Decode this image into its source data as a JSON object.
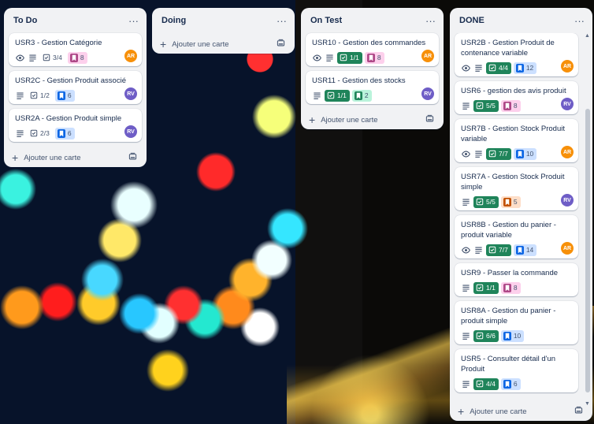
{
  "colors": {
    "check_done": "#1f845a",
    "label_pink": "#fdd0ec",
    "label_pink_icon": "#ae4787",
    "label_blue": "#cce0ff",
    "label_blue_icon": "#0c66e4",
    "label_green": "#baf3db",
    "label_green_icon": "#1f845a",
    "label_orange": "#fedec8",
    "label_orange_icon": "#c25100",
    "avatar_ar": "#f79009",
    "avatar_rv": "#6e5dc6"
  },
  "add_card_label": "Ajouter une carte",
  "menu_glyph": "···",
  "lists": [
    {
      "title": "To Do",
      "cards": [
        {
          "title": "USR3 - Gestion Catégorie",
          "checklist": "3/4",
          "label": "8",
          "avatar": "AR"
        },
        {
          "title": "USR2C - Gestion Produit associé",
          "checklist": "1/2",
          "label": "6",
          "avatar": "RV"
        },
        {
          "title": "USR2A - Gestion Produit simple",
          "checklist": "2/3",
          "label": "6",
          "avatar": "RV"
        }
      ]
    },
    {
      "title": "Doing",
      "cards": []
    },
    {
      "title": "On Test",
      "cards": [
        {
          "title": "USR10 - Gestion des commandes",
          "checklist": "1/1",
          "label": "8",
          "avatar": "AR"
        },
        {
          "title": "USR11 - Gestion des stocks",
          "checklist": "1/1",
          "label": "2",
          "avatar": "RV"
        }
      ]
    },
    {
      "title": "DONE",
      "cards": [
        {
          "title": "USR2B - Gestion Produit de contenance variable",
          "checklist": "4/4",
          "label": "12",
          "avatar": "AR"
        },
        {
          "title": "USR6 - gestion des avis produit",
          "checklist": "5/5",
          "label": "8",
          "avatar": "RV"
        },
        {
          "title": "USR7B - Gestion Stock Produit variable",
          "checklist": "7/7",
          "label": "10",
          "avatar": "AR"
        },
        {
          "title": "USR7A - Gestion Stock Produit simple",
          "checklist": "5/5",
          "label": "5",
          "avatar": "RV"
        },
        {
          "title": "USR8B - Gestion du panier - produit variable",
          "checklist": "7/7",
          "label": "14",
          "avatar": "AR"
        },
        {
          "title": "USR9 - Passer la commande",
          "checklist": "1/1",
          "label": "8"
        },
        {
          "title": "USR8A - Gestion du panier - produit simple",
          "checklist": "6/6",
          "label": "10"
        },
        {
          "title": "USR5 - Consulter détail d'un Produit",
          "checklist": "4/4",
          "label": "6"
        }
      ]
    }
  ]
}
